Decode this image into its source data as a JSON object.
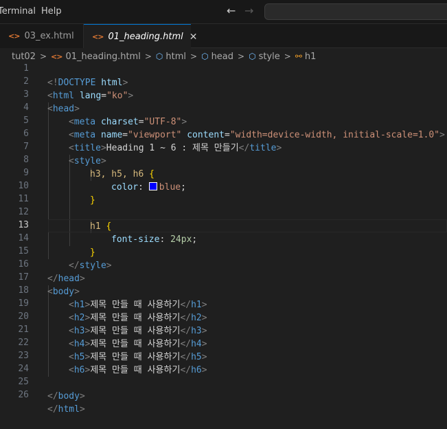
{
  "menu": {
    "terminal": "Terminal",
    "help": "Help"
  },
  "nav": {
    "back": "←",
    "forward": "→"
  },
  "tabs": [
    {
      "icon": "<>",
      "label": "03_ex.html"
    },
    {
      "icon": "<>",
      "label": "01_heading.html",
      "close": "✕"
    }
  ],
  "breadcrumb": {
    "folder": "tut02",
    "file": "01_heading.html",
    "html": "html",
    "head": "head",
    "style": "style",
    "h1": "h1",
    "sep": ">"
  },
  "editor": {
    "active_line": 13,
    "line_numbers": [
      "1",
      "2",
      "3",
      "4",
      "5",
      "6",
      "7",
      "8",
      "9",
      "10",
      "11",
      "12",
      "13",
      "14",
      "15",
      "16",
      "17",
      "18",
      "19",
      "20",
      "21",
      "22",
      "23",
      "24",
      "25",
      "26"
    ],
    "swatch_color": "#0000ff",
    "code": {
      "l1": {
        "open": "<!",
        "kw": "DOCTYPE",
        "sp": " ",
        "name": "html",
        "close": ">"
      },
      "l2": {
        "lt": "<",
        "tag": "html",
        "sp": " ",
        "attr": "lang",
        "eq": "=",
        "val": "\"ko\"",
        "gt": ">"
      },
      "l3": {
        "lt": "<",
        "tag": "head",
        "gt": ">"
      },
      "l4": {
        "lt": "<",
        "tag": "meta",
        "sp": " ",
        "attr": "charset",
        "eq": "=",
        "val": "\"UTF-8\"",
        "gt": ">"
      },
      "l5": {
        "lt": "<",
        "tag": "meta",
        "sp1": " ",
        "attr1": "name",
        "eq1": "=",
        "val1": "\"viewport\"",
        "sp2": " ",
        "attr2": "content",
        "eq2": "=",
        "val2": "\"width=device-width, initial-scale=1.0\"",
        "gt": ">"
      },
      "l6": {
        "lt": "<",
        "tag": "title",
        "gt": ">",
        "text": "Heading 1 ~ 6 : 제목 만들기",
        "clt": "</",
        "ctag": "title",
        "cgt": ">"
      },
      "l7": {
        "lt": "<",
        "tag": "style",
        "gt": ">"
      },
      "l8": {
        "sel": "h3, h5, h6",
        "sp": " ",
        "brace": "{"
      },
      "l9": {
        "prop": "color",
        "colon": ": ",
        "val": "blue",
        "semi": ";"
      },
      "l10": {
        "brace": "}"
      },
      "l12": {
        "sel": "h1",
        "sp": " ",
        "brace": "{"
      },
      "l13": {
        "prop": "font-size",
        "colon": ": ",
        "num": "24px",
        "semi": ";"
      },
      "l14": {
        "brace": "}"
      },
      "l15": {
        "lt": "</",
        "tag": "style",
        "gt": ">"
      },
      "l16": {
        "lt": "</",
        "tag": "head",
        "gt": ">"
      },
      "l17": {
        "lt": "<",
        "tag": "body",
        "gt": ">"
      },
      "headings": [
        {
          "tag": "h1",
          "text": "제목 만들 때 사용하기"
        },
        {
          "tag": "h2",
          "text": "제목 만들 때 사용하기"
        },
        {
          "tag": "h3",
          "text": "제목 만들 때 사용하기"
        },
        {
          "tag": "h4",
          "text": "제목 만들 때 사용하기"
        },
        {
          "tag": "h5",
          "text": "제목 만들 때 사용하기"
        },
        {
          "tag": "h6",
          "text": "제목 만들 때 사용하기"
        }
      ],
      "lt": "<",
      "clt": "</",
      "gt": ">",
      "l25": {
        "lt": "</",
        "tag": "body",
        "gt": ">"
      },
      "l26": {
        "lt": "</",
        "tag": "html",
        "gt": ">"
      }
    }
  }
}
